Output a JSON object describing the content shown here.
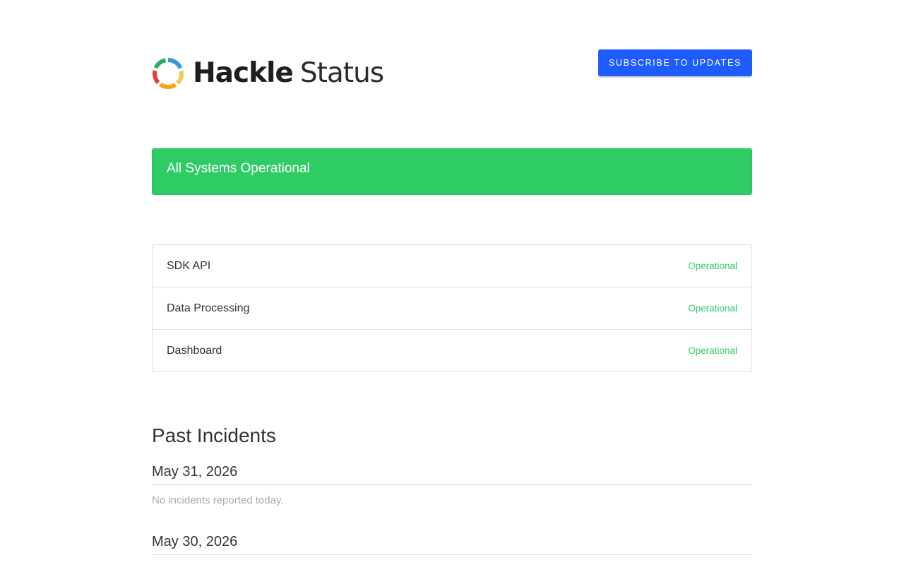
{
  "header": {
    "logo_brand": "Hackle",
    "logo_suffix": "Status",
    "logo_icon": "hackle-ring-logo",
    "subscribe_label": "Subscribe to Updates"
  },
  "banner": {
    "text": "All Systems Operational",
    "color": "#2fcc66"
  },
  "components": [
    {
      "name": "SDK API",
      "status": "Operational"
    },
    {
      "name": "Data Processing",
      "status": "Operational"
    },
    {
      "name": "Dashboard",
      "status": "Operational"
    }
  ],
  "incidents": {
    "title": "Past Incidents",
    "days": [
      {
        "date": "May 31, 2026",
        "body": "No incidents reported today."
      },
      {
        "date": "May 30, 2026",
        "body": ""
      }
    ]
  },
  "colors": {
    "accent": "#1f5cff",
    "operational": "#2fcc66"
  }
}
